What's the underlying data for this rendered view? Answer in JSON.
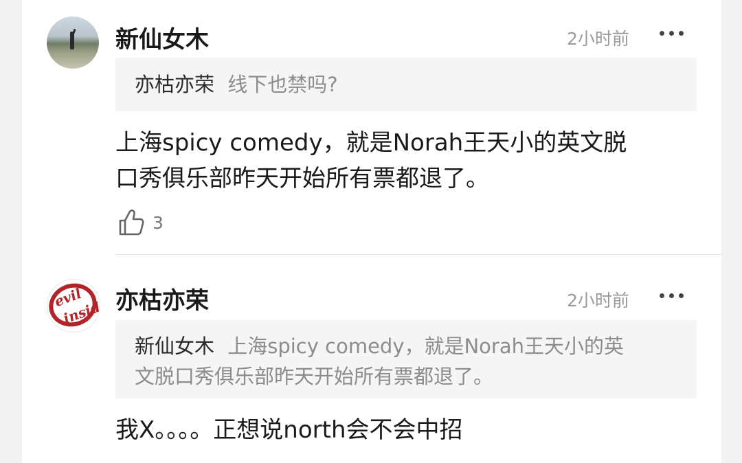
{
  "comments": [
    {
      "username": "新仙女木",
      "time": "2小时前",
      "quote_user": "亦枯亦荣",
      "quote_text": "线下也禁吗?",
      "body_line1": "上海spicy comedy，就是Norah王天小的英文脱",
      "body_line2": "口秀俱乐部昨天开始所有票都退了。",
      "likes": "3",
      "avatar_icon": "person-landscape-photo",
      "more_icon": "ellipsis-icon"
    },
    {
      "username": "亦枯亦荣",
      "time": "2小时前",
      "quote_user": "新仙女木",
      "quote_text_line1": "上海spicy comedy，就是Norah王天小的英",
      "quote_text_line2": "文脱口秀俱乐部昨天开始所有票都退了。",
      "body_line1": "我X。。。。正想说north会不会中招",
      "avatar_logo_line1": "evil",
      "avatar_logo_line2": "inside",
      "more_icon": "ellipsis-icon"
    }
  ],
  "colors": {
    "logo_red": "#b2242a",
    "quote_bg": "#f5f5f5",
    "muted_text": "#9a9a9a"
  }
}
